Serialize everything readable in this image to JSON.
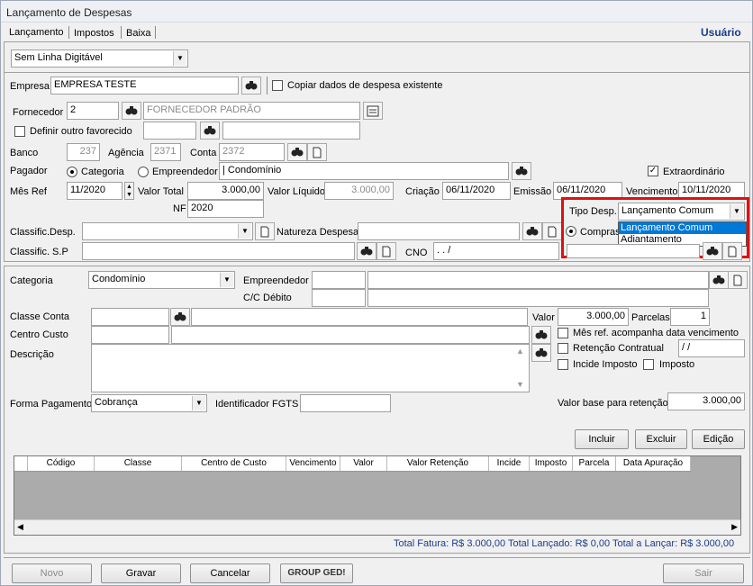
{
  "window": {
    "title": "Lançamento de Despesas"
  },
  "tabs": [
    "Lançamento",
    "Impostos",
    "Baixa"
  ],
  "user_label": "Usuário",
  "top": {
    "linha": "Sem Linha Digitável",
    "empresa_label": "Empresa",
    "empresa_value": "EMPRESA TESTE",
    "copiar_label": "Copiar dados de despesa existente",
    "fornecedor_label": "Fornecedor",
    "fornecedor_code": "2",
    "fornecedor_name": "FORNECEDOR PADRÃO",
    "definir_label": "Definir outro favorecido",
    "banco_label": "Banco",
    "banco_value": "237",
    "agencia_label": "Agência",
    "agencia_value": "2371",
    "conta_label": "Conta",
    "conta_value": "2372",
    "pagador_label": "Pagador",
    "categoria_radio": "Categoria",
    "empreendedor_radio": "Empreendedor",
    "pagador_value": "| Condomínio",
    "extraordinario_label": "Extraordinário",
    "mesref_label": "Mês Ref",
    "mesref_value": "11/2020",
    "valortotal_label": "Valor Total",
    "valortotal_value": "3.000,00",
    "valorliquido_label": "Valor Líquido",
    "valorliquido_value": "3.000,00",
    "criacao_label": "Criação",
    "criacao_value": "06/11/2020",
    "emissao_label": "Emissão",
    "emissao_value": "06/11/2020",
    "vencimento_label": "Vencimento",
    "vencimento_value": "10/11/2020",
    "nf_label": "NF",
    "nf_value": "2020",
    "tipodesp_label": "Tipo Desp.",
    "tipodesp_value": "Lançamento Comum",
    "tipodesp_options": [
      "Lançamento Comum",
      "Adiantamento"
    ],
    "compras_label": "Compras",
    "classif_desp_label": "Classific.Desp.",
    "natureza_label": "Natureza Despesa",
    "classif_sp_label": "Classific. S.P",
    "cno_label": "CNO",
    "cno_value": ". .      /"
  },
  "bottom": {
    "categoria_label": "Categoria",
    "categoria_value": "Condomínio",
    "empreendedor_label": "Empreendedor",
    "ccdebito_label": "C/C Débito",
    "classeconta_label": "Classe Conta",
    "valor_label": "Valor",
    "valor_value": "3.000,00",
    "parcelas_label": "Parcelas",
    "parcelas_value": "1",
    "centrocusto_label": "Centro Custo",
    "mesref_acomp_label": "Mês ref. acompanha data vencimento",
    "descricao_label": "Descrição",
    "retencao_label": "Retenção Contratual",
    "retencao_value": "/ /",
    "incide_label": "Incide Imposto",
    "imposto_label": "Imposto",
    "formapag_label": "Forma Pagamento",
    "formapag_value": "Cobrança",
    "fgts_label": "Identificador FGTS",
    "valorbase_label": "Valor base para retenção",
    "valorbase_value": "3.000,00",
    "incluir": "Incluir",
    "excluir": "Excluir",
    "edicao": "Edição"
  },
  "grid": {
    "columns": [
      "Código",
      "Classe",
      "Centro de Custo",
      "Vencimento",
      "Valor",
      "Valor Retenção",
      "Incide",
      "Imposto",
      "Parcela",
      "Data Apuração"
    ]
  },
  "totals": "Total Fatura: R$ 3.000,00  Total Lançado: R$ 0,00  Total a Lançar: R$ 3.000,00",
  "footer": {
    "novo": "Novo",
    "gravar": "Gravar",
    "cancelar": "Cancelar",
    "ged": "GROUP GED!",
    "sair": "Sair"
  },
  "colors": {
    "highlight": "#e01010",
    "selection": "#0078d7",
    "user": "#1a3d8c"
  }
}
